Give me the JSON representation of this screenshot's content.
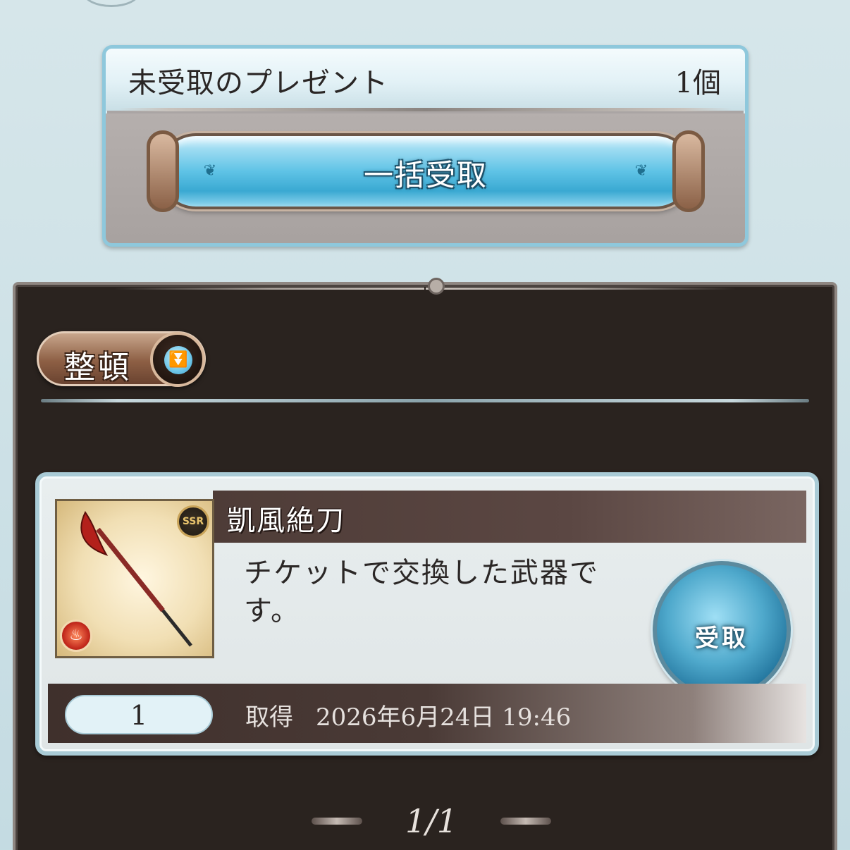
{
  "summary": {
    "label": "未受取のプレゼント",
    "count": "1個",
    "claim_all_label": "一括受取"
  },
  "list": {
    "sort_label": "整頓",
    "sort_icon": "double-chevron-down-icon",
    "items": [
      {
        "name": "凱風絶刀",
        "description": "チケットで交換した武器です。",
        "rarity": "SSR",
        "element_icon": "fire-element-icon",
        "quantity": "1",
        "received_label": "取得",
        "received_at": "2026年6月24日 19:46",
        "receive_button_label": "受取"
      }
    ],
    "pagination": "1/1"
  },
  "colors": {
    "accent": "#5fc3e6",
    "panel_dark": "#2a231f",
    "border_light": "#a9cbd6"
  }
}
